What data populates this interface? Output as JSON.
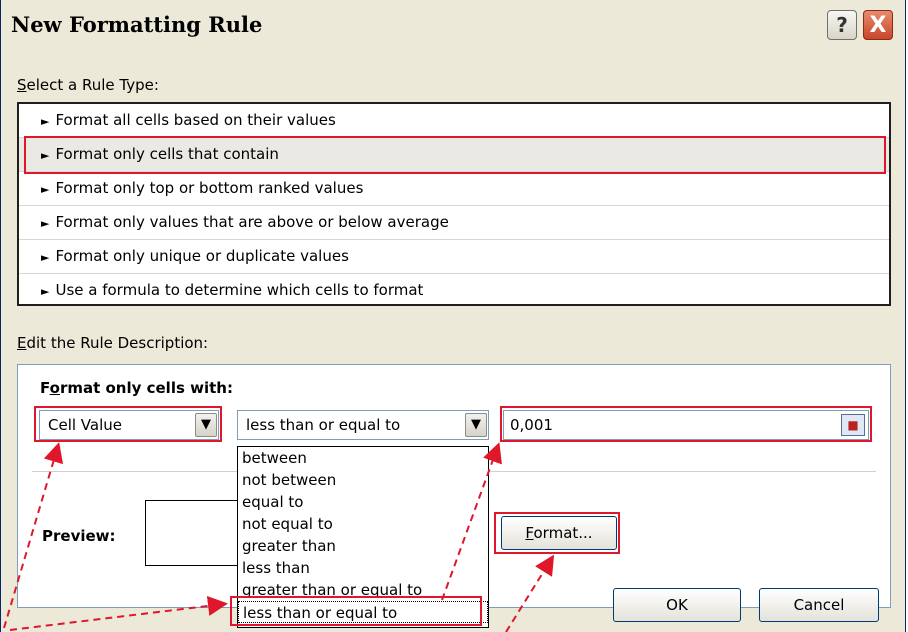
{
  "dialog": {
    "title": "New Formatting Rule",
    "help_icon": "?",
    "close_icon": "X"
  },
  "rule_type": {
    "label_first": "S",
    "label_rest": "elect a Rule Type:",
    "items": [
      {
        "label": "Format all cells based on their values"
      },
      {
        "label": "Format only cells that contain"
      },
      {
        "label": "Format only top or bottom ranked values"
      },
      {
        "label": "Format only values that are above or below average"
      },
      {
        "label": "Format only unique or duplicate values"
      },
      {
        "label": "Use a formula to determine which cells to format"
      }
    ],
    "selected_index": 1,
    "arrow_glyph": "►"
  },
  "rule_description": {
    "label_first": "E",
    "label_rest": "dit the Rule Description:",
    "heading_first": "F",
    "heading_first_rest": "o",
    "heading_underlined": "o",
    "heading_prefix": "F",
    "heading_suffix": "rmat only cells with:",
    "type_combo_value": "Cell Value",
    "operator_combo_value": "less than or equal to",
    "value_input": "0,001",
    "operator_options": [
      "between",
      "not between",
      "equal to",
      "not equal to",
      "greater than",
      "less than",
      "greater than or equal to",
      "less than or equal to"
    ],
    "selected_option_index": 7,
    "preview_label": "Preview:",
    "format_button_first": "F",
    "format_button_rest": "ormat...",
    "dropdown_glyph": "▼"
  },
  "footer": {
    "ok_label": "OK",
    "cancel_label": "Cancel"
  },
  "colors": {
    "annotation_red": "#e0162b",
    "dialog_bg": "#ece9d8",
    "border_blue": "#7f9db9"
  }
}
